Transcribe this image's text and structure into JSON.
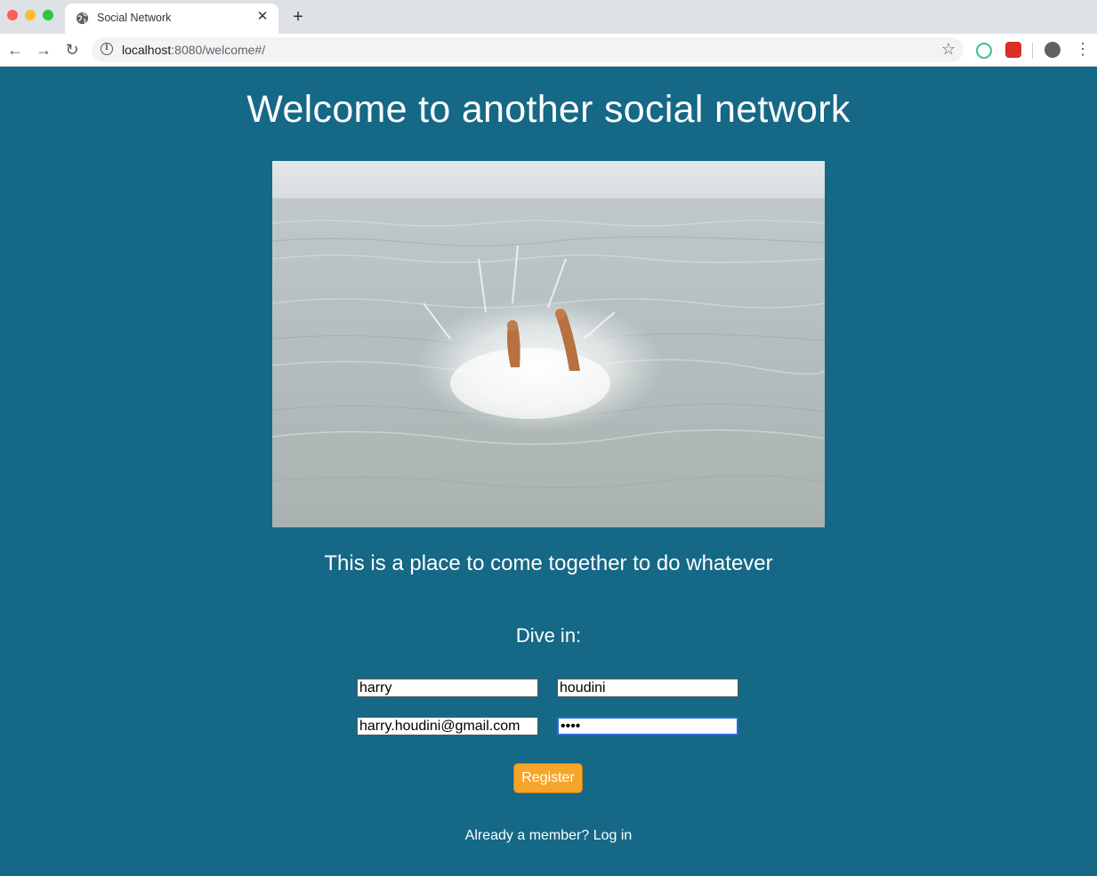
{
  "browser": {
    "tab_title": "Social Network",
    "tab_close": "✕",
    "new_tab": "+",
    "url_host": "localhost",
    "url_path": ":8080/welcome#/",
    "back": "←",
    "forward": "→",
    "reload": "↻",
    "star": "☆",
    "menu": "⋮"
  },
  "page": {
    "heading": "Welcome to another social network",
    "tagline": "This is a place to come together to do whatever",
    "dive_in": "Dive in:",
    "register_label": "Register",
    "already_member": "Already a member?",
    "login_link": "Log in"
  },
  "form": {
    "first_name": "harry",
    "last_name": "houdini",
    "email": "harry.houdini@gmail.com",
    "password": "abcd"
  },
  "colors": {
    "background": "#156886",
    "register_button": "#f6a52b"
  }
}
